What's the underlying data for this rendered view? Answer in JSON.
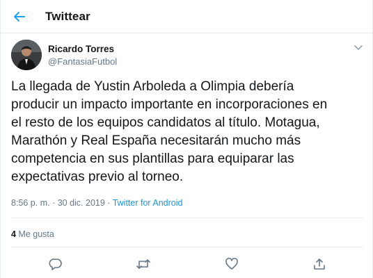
{
  "header": {
    "title": "Twittear"
  },
  "tweet": {
    "author_name": "Ricardo Torres",
    "author_handle": "@FantasiaFutbol",
    "text": "La llegada de Yustin Arboleda a Olimpia debería\nproducir un impacto importante en incorporaciones en\nel resto de los equipos candidatos al título. Motagua,\nMarathón y Real España necesitarán mucho más\ncompetencia en sus plantillas para equiparar las\nexpectativas previo al torneo.",
    "time": "8:56 p. m.",
    "separator": " · ",
    "date": "30 dic. 2019",
    "source": "Twitter for Android",
    "likes_count": "4",
    "likes_label": " Me gusta"
  },
  "colors": {
    "accent": "#1da1f2",
    "text": "#14171a",
    "secondary": "#657786",
    "divider": "#e6ecf0"
  },
  "icons": {
    "back": "arrow-left-icon",
    "caret": "chevron-down-icon",
    "reply": "reply-icon",
    "retweet": "retweet-icon",
    "like": "heart-icon",
    "share": "share-icon"
  }
}
